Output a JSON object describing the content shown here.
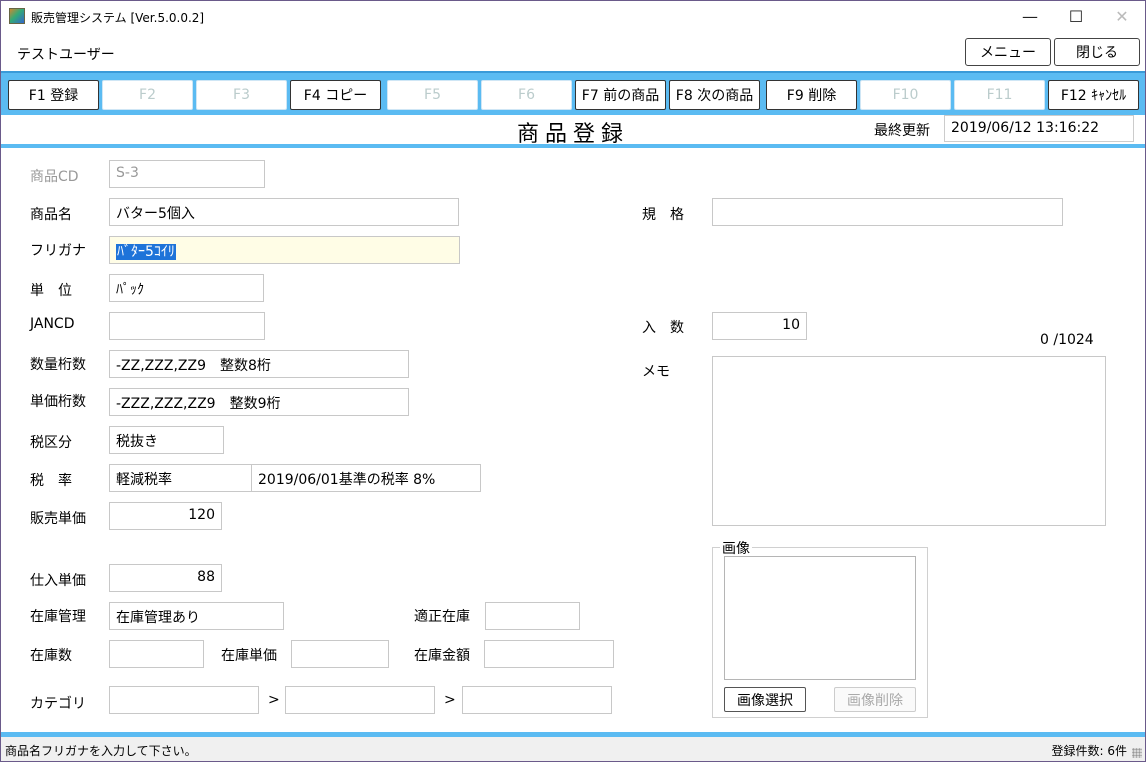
{
  "window": {
    "title": "販売管理システム [Ver.5.0.0.2]",
    "minimize": "—",
    "maximize": "☐",
    "close": "✕"
  },
  "subbar": {
    "user": "テストユーザー",
    "menu_label": "メニュー",
    "close_label": "閉じる"
  },
  "fkeys": {
    "f1": "F1 登録",
    "f2": "F2",
    "f3": "F3",
    "f4": "F4 コピー",
    "f5": "F5",
    "f6": "F6",
    "f7": "F7 前の商品",
    "f8": "F8 次の商品",
    "f9": "F9 削除",
    "f10": "F10",
    "f11": "F11",
    "f12": "F12 ｷｬﾝｾﾙ"
  },
  "header": {
    "title": "商品登録",
    "last_updated_label": "最終更新",
    "last_updated_value": "2019/06/12 13:16:22"
  },
  "form": {
    "code_label": "商品CD",
    "code_value": "S-3",
    "name_label": "商品名",
    "name_value": "バター5個入",
    "kana_label": "フリガナ",
    "kana_value": "ﾊﾞﾀｰ5ｺｲﾘ",
    "unit_label": "単　位",
    "unit_value": "ﾊﾟｯｸ",
    "jan_label": "JANCD",
    "jan_value": "",
    "qty_digits_label": "数量桁数",
    "qty_digits_value": "-ZZ,ZZZ,ZZ9　整数8桁",
    "price_digits_label": "単価桁数",
    "price_digits_value": "-ZZZ,ZZZ,ZZ9　整数9桁",
    "tax_class_label": "税区分",
    "tax_class_value": "税抜き",
    "tax_rate_label": "税　率",
    "tax_rate_value": "軽減税率",
    "tax_rate_note": "2019/06/01基準の税率 8%",
    "sale_price_label": "販売単価",
    "sale_price_value": "120",
    "purchase_price_label": "仕入単価",
    "purchase_price_value": "88",
    "stock_mgmt_label": "在庫管理",
    "stock_mgmt_value": "在庫管理あり",
    "proper_stock_label": "適正在庫",
    "proper_stock_value": "",
    "stock_qty_label": "在庫数",
    "stock_qty_value": "",
    "stock_unit_price_label": "在庫単価",
    "stock_unit_price_value": "",
    "stock_amount_label": "在庫金額",
    "stock_amount_value": "",
    "category_label": "カテゴリ",
    "category_sep": ">",
    "category_1": "",
    "category_2": "",
    "category_3": "",
    "spec_label": "規　格",
    "spec_value": "",
    "qty_per_label": "入　数",
    "qty_per_value": "10",
    "memo_label": "メモ",
    "memo_count": "0 /1024",
    "memo_value": ""
  },
  "image": {
    "group_title": "画像",
    "select_label": "画像選択",
    "delete_label": "画像削除"
  },
  "status": {
    "message": "商品名フリガナを入力して下さい。",
    "count": "登録件数: 6件"
  }
}
